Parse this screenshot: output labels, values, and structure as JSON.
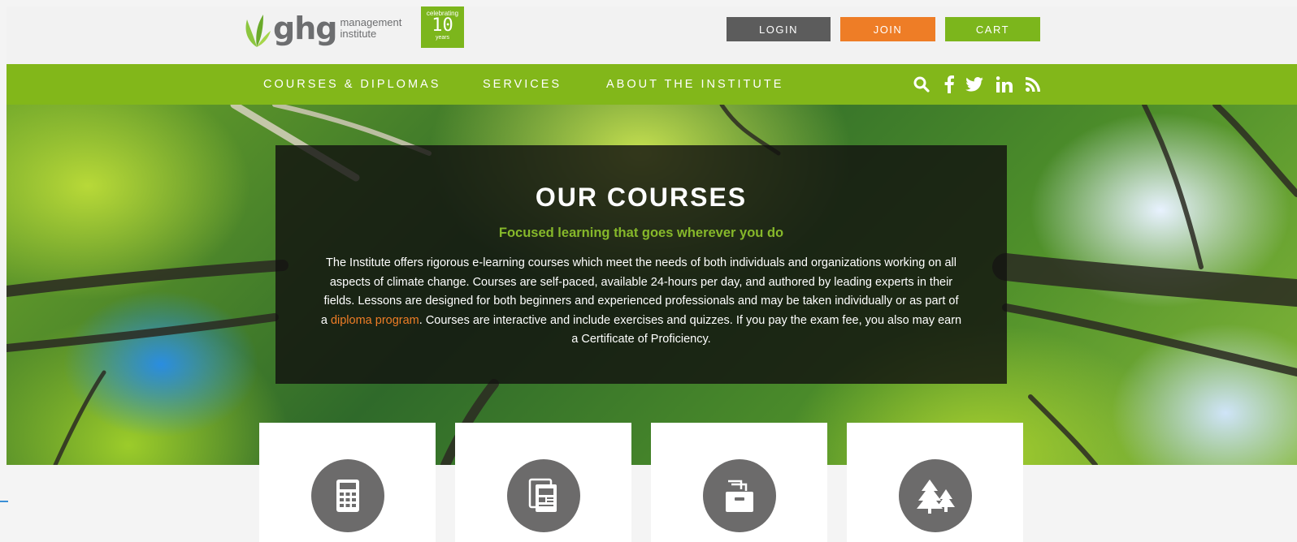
{
  "header": {
    "logo_text": "ghg",
    "logo_sub_1": "management",
    "logo_sub_2": "institute",
    "badge_top": "celebrating",
    "badge_number": "10",
    "badge_bottom": "years",
    "login_label": "LOGIN",
    "join_label": "JOIN",
    "cart_label": "CART"
  },
  "nav": {
    "items": [
      {
        "label": "COURSES & DIPLOMAS"
      },
      {
        "label": "SERVICES"
      },
      {
        "label": "ABOUT THE INSTITUTE"
      }
    ],
    "icons": [
      "search-icon",
      "facebook-icon",
      "twitter-icon",
      "linkedin-icon",
      "rss-icon"
    ]
  },
  "hero": {
    "title": "OUR COURSES",
    "subtitle": "Focused learning that goes wherever you do",
    "body_part1": "The Institute offers rigorous e-learning courses which meet the needs of both individuals and organizations working on all aspects of climate change. Courses are self-paced, available 24-hours per day, and authored by leading experts in their fields. Lessons are designed for both beginners and experienced professionals and may be taken individually or as part of a ",
    "body_link": "diploma program",
    "body_part2": ".  Courses are interactive and include exercises and quizzes. If you pay the exam fee, you also may earn a Certificate of Proficiency."
  },
  "cards": [
    {
      "icon": "calculator-icon"
    },
    {
      "icon": "report-document-icon"
    },
    {
      "icon": "file-cabinet-icon"
    },
    {
      "icon": "pine-trees-icon"
    }
  ],
  "colors": {
    "brand_green": "#82b71a",
    "accent_orange": "#ee7d26",
    "login_gray": "#5c5c5c",
    "icon_gray": "#6c6b6b"
  }
}
